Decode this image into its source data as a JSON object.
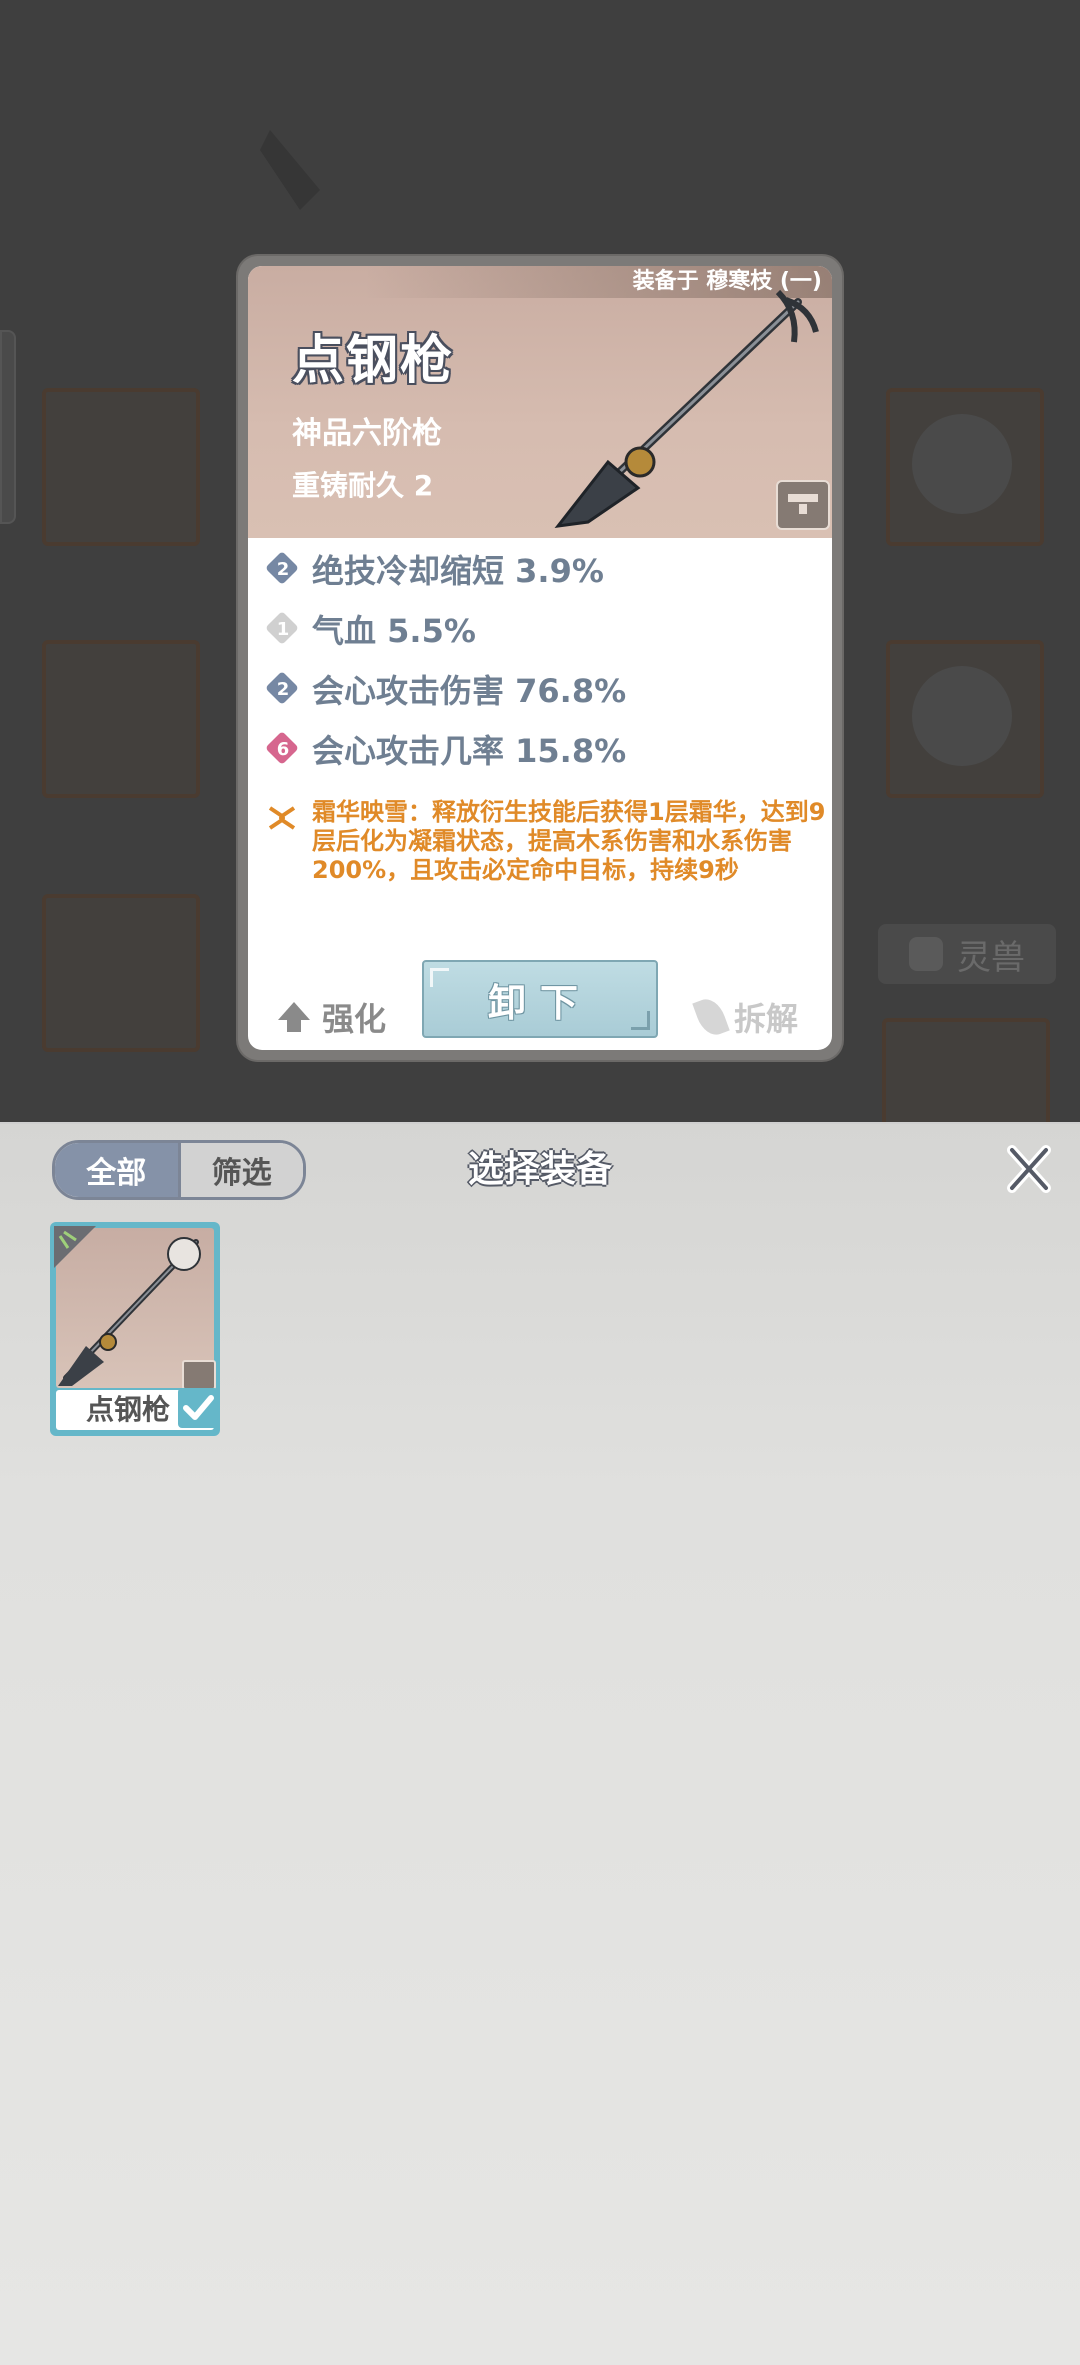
{
  "card": {
    "equipped_on": "装备于 穆寒枝 (一)",
    "item_name": "点钢枪",
    "grade": "神品六阶枪",
    "durability": "重铸耐久 2",
    "stats": [
      {
        "badge": "2",
        "text": "绝技冷却缩短 3.9%"
      },
      {
        "badge": "1",
        "text": "气血 5.5%"
      },
      {
        "badge": "2",
        "text": "会心攻击伤害 76.8%"
      },
      {
        "badge": "6",
        "text": "会心攻击几率 15.8%"
      }
    ],
    "passive": "霜华映雪：释放衍生技能后获得1层霜华，达到9层后化为凝霜状态，提高木系伤害和水系伤害 200%，且攻击必定命中目标，持续9秒",
    "actions": {
      "strengthen": "强化",
      "unequip": "卸下",
      "dismantle": "拆解"
    }
  },
  "background": {
    "beast_button": "灵兽"
  },
  "panel": {
    "title": "选择装备",
    "tabs": [
      "全部",
      "筛选"
    ],
    "items": [
      {
        "label": "点钢枪",
        "selected": true
      }
    ]
  },
  "colors": {
    "accent_orange": "#e08a28",
    "stat_text": "#6f7f92",
    "tab_active": "#8592a8",
    "slot_selected": "#65b7c9"
  }
}
